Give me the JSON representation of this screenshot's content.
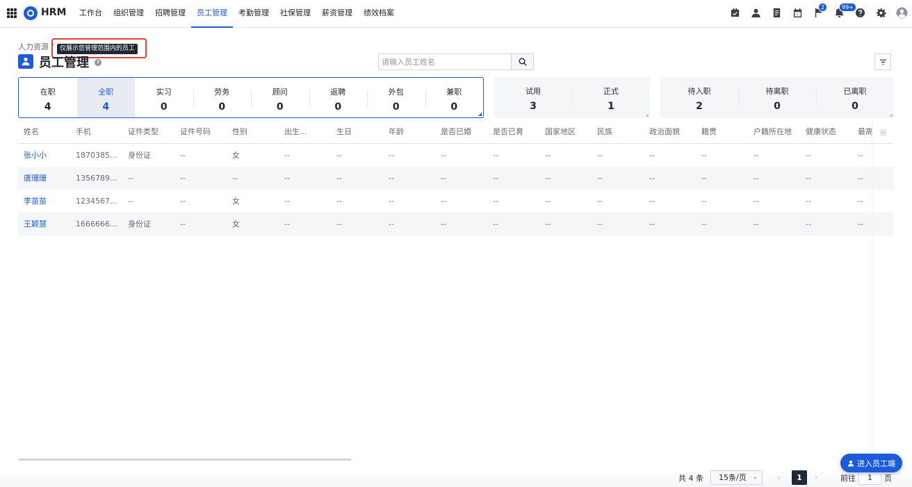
{
  "app": {
    "brand": "HRM"
  },
  "nav": [
    "工作台",
    "组织管理",
    "招聘管理",
    "员工管理",
    "考勤管理",
    "社保管理",
    "薪资管理",
    "绩效档案"
  ],
  "nav_active": 3,
  "toolbar": {
    "icons": [
      "todo-check-icon",
      "user-icon",
      "document-icon",
      "calendar-icon",
      "flag-icon",
      "bell-icon",
      "help-icon",
      "gear-icon",
      "avatar-icon"
    ],
    "flag_badge": "2",
    "bell_badge": "99+"
  },
  "breadcrumb": {
    "root": "人力资源",
    "separator": "/"
  },
  "tooltip": "仅展示您管理范围内的员工",
  "page": {
    "title": "员工管理",
    "help": "?"
  },
  "search": {
    "placeholder": "请输入员工姓名"
  },
  "stats": {
    "main": [
      {
        "label": "在职",
        "value": "4"
      },
      {
        "label": "全职",
        "value": "4"
      },
      {
        "label": "实习",
        "value": "0"
      },
      {
        "label": "劳务",
        "value": "0"
      },
      {
        "label": "顾问",
        "value": "0"
      },
      {
        "label": "返聘",
        "value": "0"
      },
      {
        "label": "外包",
        "value": "0"
      },
      {
        "label": "兼职",
        "value": "0"
      }
    ],
    "main_selected": 1,
    "probation": [
      {
        "label": "试用",
        "value": "3"
      },
      {
        "label": "正式",
        "value": "1"
      }
    ],
    "status": [
      {
        "label": "待入职",
        "value": "2"
      },
      {
        "label": "待离职",
        "value": "0"
      },
      {
        "label": "已离职",
        "value": "0"
      }
    ]
  },
  "table": {
    "columns": [
      "姓名",
      "手机",
      "证件类型",
      "证件号码",
      "性别",
      "出生...",
      "生日",
      "年龄",
      "是否已婚",
      "是否已育",
      "国家地区",
      "民族",
      "政治面貌",
      "籍贯",
      "户籍所在地",
      "健康状态",
      "最高"
    ],
    "column_tool": "卌",
    "rows": [
      [
        "张小小",
        "1870385...",
        "身份证",
        "--",
        "女",
        "--",
        "--",
        "--",
        "--",
        "--",
        "--",
        "--",
        "--",
        "--",
        "--",
        "--",
        "--"
      ],
      [
        "唐珊珊",
        "1356789...",
        "--",
        "--",
        "--",
        "--",
        "--",
        "--",
        "--",
        "--",
        "--",
        "--",
        "--",
        "--",
        "--",
        "--",
        "--"
      ],
      [
        "李苗苗",
        "1234567...",
        "--",
        "--",
        "女",
        "--",
        "--",
        "--",
        "--",
        "--",
        "--",
        "--",
        "--",
        "--",
        "--",
        "--",
        "--"
      ],
      [
        "王颖慧",
        "1666666...",
        "身份证",
        "--",
        "女",
        "--",
        "--",
        "--",
        "--",
        "--",
        "--",
        "--",
        "--",
        "--",
        "--",
        "--",
        "--"
      ]
    ]
  },
  "pagination": {
    "total": "共 4 条",
    "page_size": "15条/页",
    "prev": "‹",
    "current": "1",
    "next": "›",
    "goto_label": "前往",
    "goto_value": "1",
    "goto_unit": "页"
  },
  "enter_button": "进入员工端",
  "colors": {
    "primary": "#1d5bd8",
    "highlight_frame": "#e2442f",
    "dark": "#1f2933"
  }
}
